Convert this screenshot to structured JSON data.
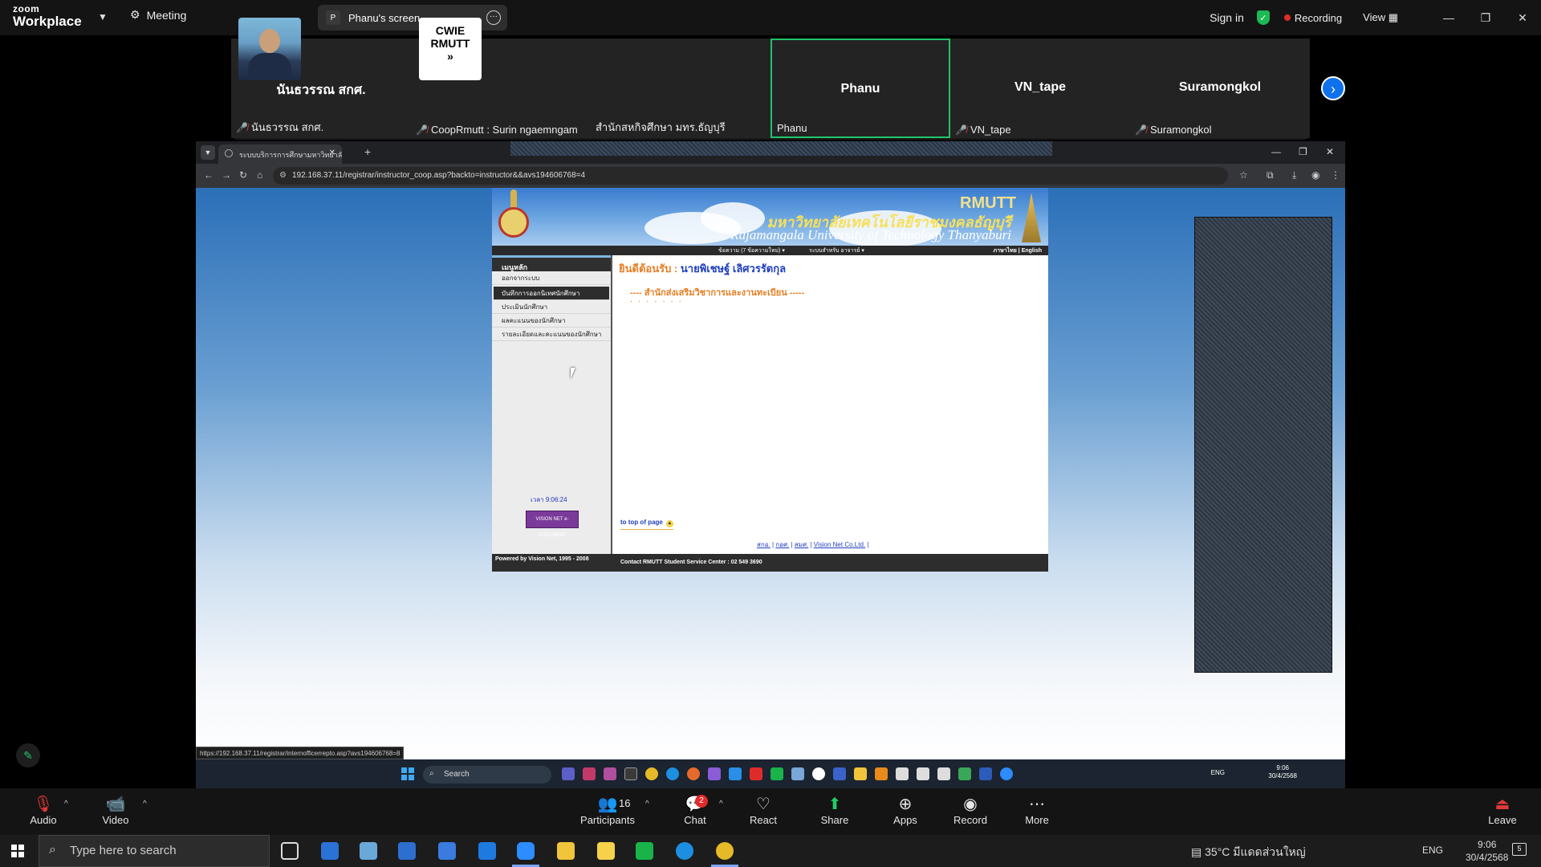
{
  "zoom": {
    "brand_line1": "zoom",
    "brand_line2": "Workplace",
    "meeting_label": "Meeting",
    "screen_badge": "P",
    "screen_label": "Phanu's screen",
    "sign_in": "Sign in",
    "recording": "Recording",
    "view": "View",
    "colors": {
      "accent": "#0e71eb",
      "active_speaker": "#21c46b",
      "muted": "#e23a3a",
      "recording": "#e02b2b"
    }
  },
  "participants": [
    {
      "tile_name": "นันธวรรณ สกศ.",
      "caption": "นันธวรรณ สกศ.",
      "muted": true
    },
    {
      "tile_name": "",
      "caption": "CoopRmutt : Surin ngaemngam",
      "muted": true,
      "has_photo": true
    },
    {
      "tile_name": "",
      "caption": "สำนักสหกิจศึกษา มทร.ธัญบุรี",
      "muted": false,
      "logo_text": [
        "CWIE",
        "RMUTT",
        "»"
      ]
    },
    {
      "tile_name": "Phanu",
      "caption": "Phanu",
      "muted": false,
      "active": true
    },
    {
      "tile_name": "VN_tape",
      "caption": "VN_tape",
      "muted": true
    },
    {
      "tile_name": "Suramongkol",
      "caption": "Suramongkol",
      "muted": true
    }
  ],
  "browser": {
    "tab_title": "ระบบบริการการศึกษามหาวิทยาลัย",
    "url": "192.168.37.11/registrar/instructor_coop.asp?backto=instructor&&avs194606768=4",
    "status_url": "https://192.168.37.11/registrar/internofficerrepto.asp?avs194606768=8"
  },
  "site": {
    "banner_rmutt": "RMUTT",
    "banner_th": "มหาวิทยาลัยเทคโนโลยีราชมงคลธัญบุรี",
    "banner_en": "Rajamangala University of Technology Thanyaburi",
    "menubar_msg": "ข้อความ (7 ข้อความใหม่) ▾",
    "menubar_sys": "ระบบสำหรับ อาจารย์ ▾",
    "menubar_lang": "ภาษาไทย | English",
    "nav_head": "เมนูหลัก",
    "nav_items": [
      "ออกจากระบบ",
      "บันทึกการออกนิเทศนักศึกษา",
      "ประเมินนักศึกษา",
      "ผลคะแนนของนักศึกษา",
      "รายละเอียดและคะแนนของนักศึกษา"
    ],
    "nav_selected_index": 1,
    "time": "เวลา 9:06:24",
    "vn_badge": "VISION NET e-DOCUMENT",
    "welcome_prefix": "ยินดีต้อนรับ :",
    "welcome_name": "นายพิเชษฐ์ เลิศวรรัตกุล",
    "dept": "---- สำนักส่งเสริมวิชาการและงานทะเบียน -----",
    "dots": ". . . . . . .",
    "to_top": "to top of page",
    "footer_links": [
      "สกอ.",
      "กอศ.",
      "สมศ.",
      "Vision Net Co.Ltd."
    ],
    "powered": "Powered by Vision Net, 1995 - 2008",
    "contact": "Contact RMUTT Student Service Center : 02 549 3690"
  },
  "inner_taskbar": {
    "search": "Search",
    "lang": "ENG",
    "time": "9:06",
    "date": "30/4/2568"
  },
  "toolbar": {
    "audio": "Audio",
    "video": "Video",
    "participants": "Participants",
    "participants_count": "16",
    "chat": "Chat",
    "chat_badge": "2",
    "react": "React",
    "share": "Share",
    "apps": "Apps",
    "record": "Record",
    "more": "More",
    "leave": "Leave"
  },
  "host_taskbar": {
    "search_placeholder": "Type here to search",
    "weather": "35°C มีแดดส่วนใหญ่",
    "lang": "ENG",
    "time": "9:06",
    "date": "30/4/2568",
    "notif_count": "5"
  }
}
